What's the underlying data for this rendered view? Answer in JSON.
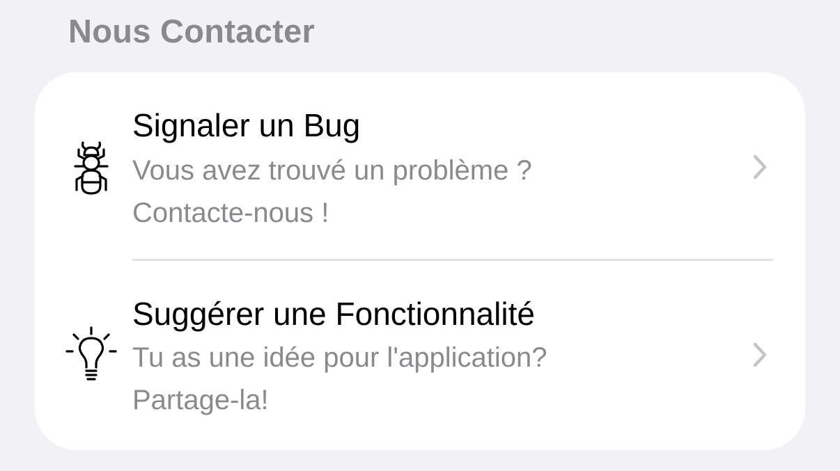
{
  "section": {
    "title": "Nous Contacter"
  },
  "rows": [
    {
      "icon": "bug-icon",
      "title": "Signaler un Bug",
      "subtitle_line1": "Vous avez trouvé un problème ?",
      "subtitle_line2": "Contacte-nous !"
    },
    {
      "icon": "lightbulb-icon",
      "title": "Suggérer une Fonctionnalité",
      "subtitle_line1": "Tu as une idée pour l'application?",
      "subtitle_line2": "Partage-la!"
    }
  ],
  "colors": {
    "background": "#f2f1f6",
    "card": "#ffffff",
    "primary_text": "#000000",
    "secondary_text": "#8a8a8e",
    "chevron": "#c4c4c7",
    "separator": "#e2e2e6"
  }
}
